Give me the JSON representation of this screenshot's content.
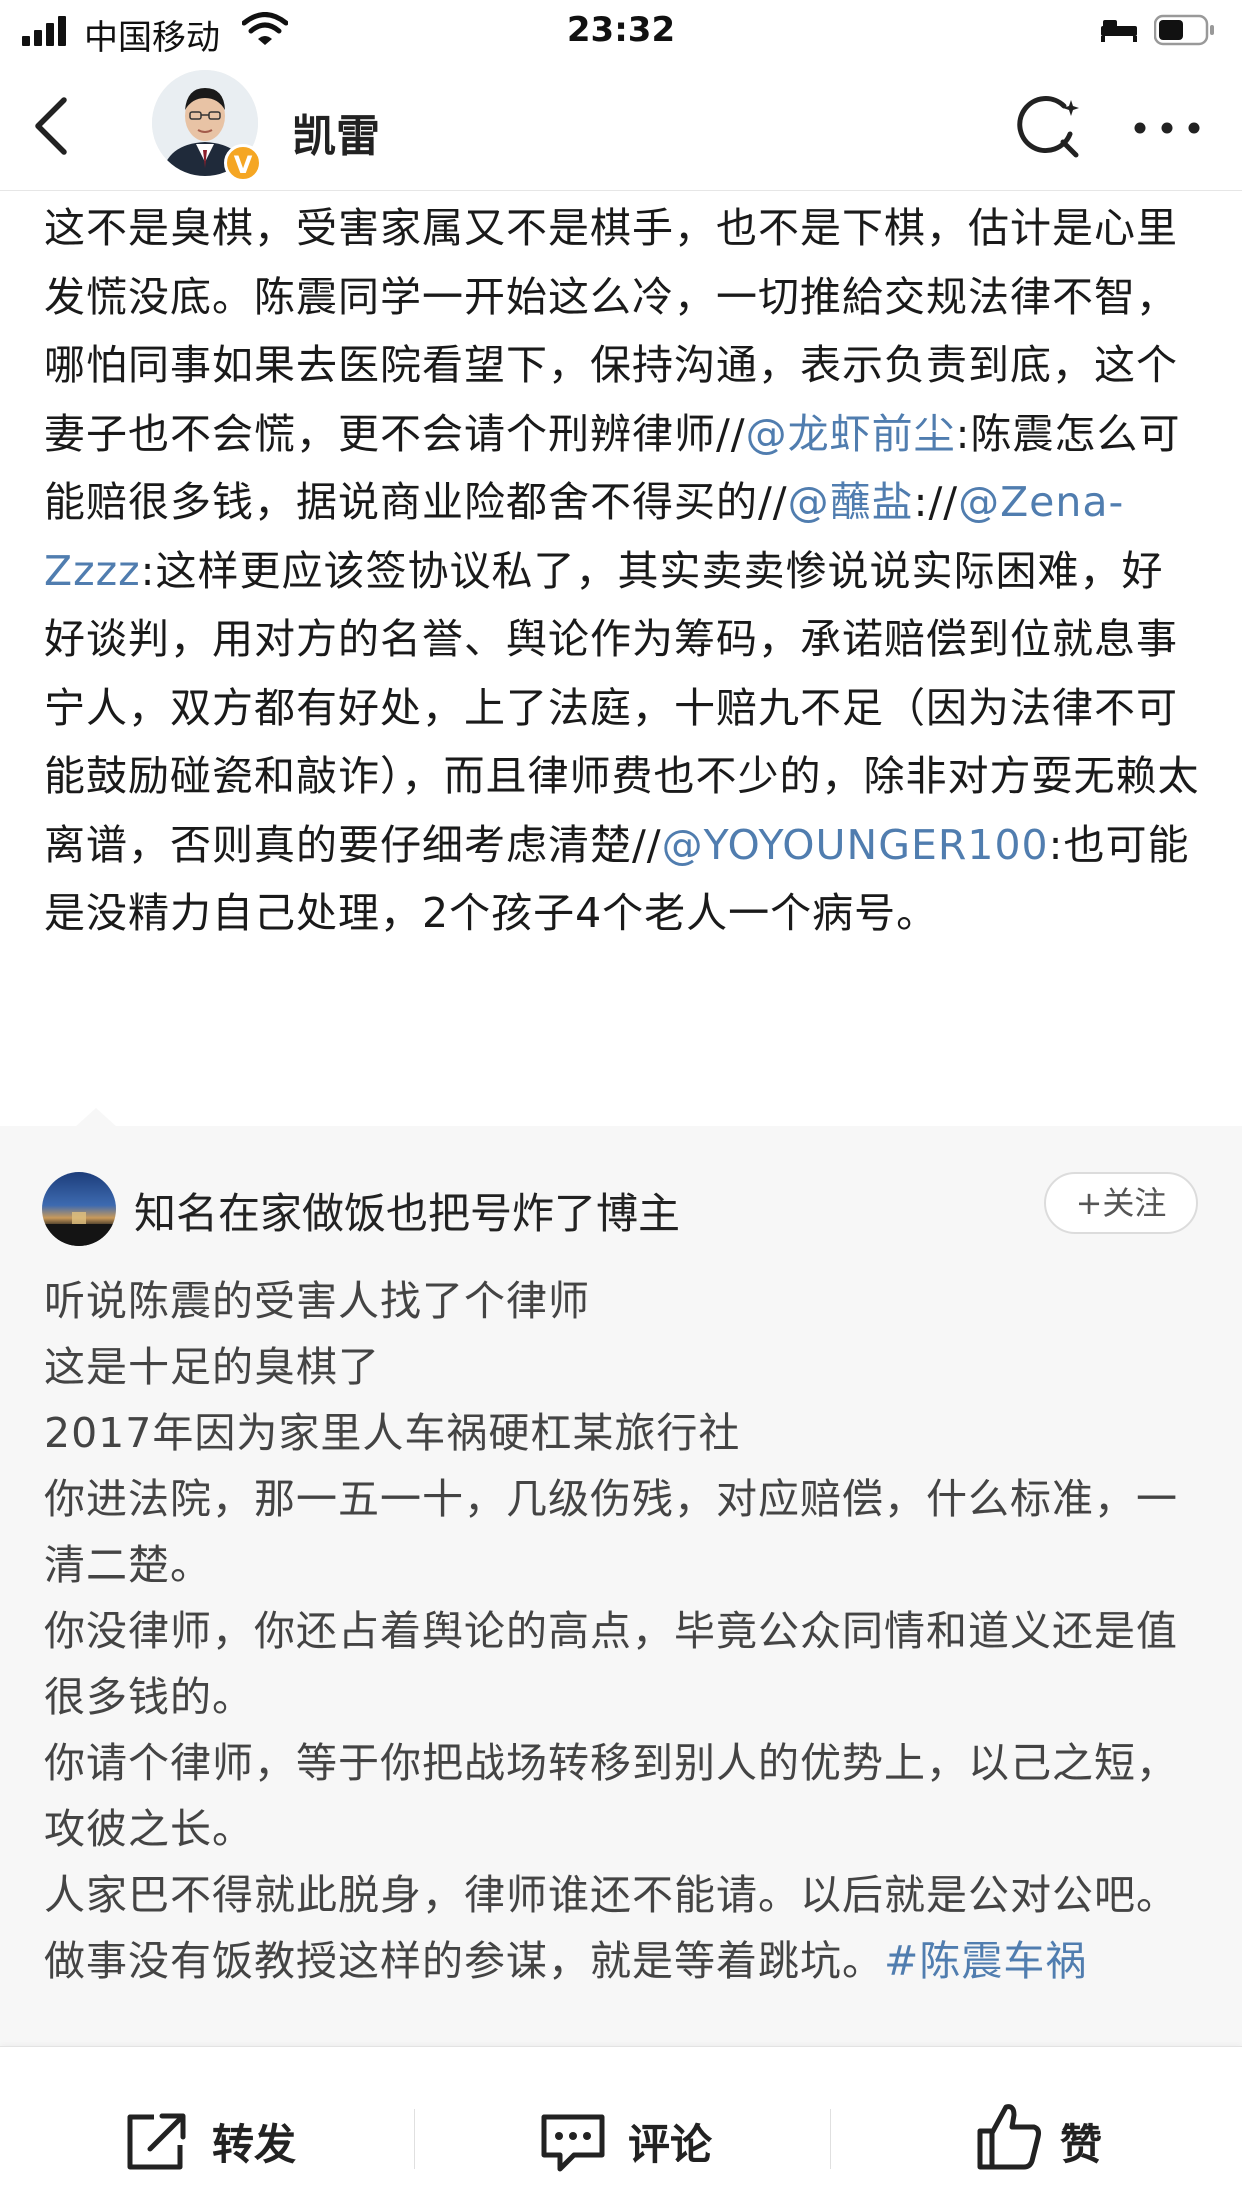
{
  "status_bar": {
    "carrier": "中国移动",
    "time": "23:32"
  },
  "header": {
    "username": "凯雷",
    "verified_badge": "V"
  },
  "post": {
    "segments": [
      {
        "type": "text",
        "text": "这不是臭棋，受害家属又不是棋手，也不是下棋，估计是心里发慌没底。陈震同学一开始这么冷，一切推給交规法律不智，哪怕同事如果去医院看望下，保持沟通，表示负责到底，这个妻子也不会慌，更不会请个刑辨律师//"
      },
      {
        "type": "mention",
        "text": "@龙虾前尘"
      },
      {
        "type": "text",
        "text": ":陈震怎么可能赔很多钱，据说商业险都舍不得买的//"
      },
      {
        "type": "mention",
        "text": "@蘸盐"
      },
      {
        "type": "text",
        "text": "://"
      },
      {
        "type": "mention",
        "text": "@Zena-Zzzz"
      },
      {
        "type": "text",
        "text": ":这样更应该签协议私了，其实卖卖惨说说实际困难，好好谈判，用对方的名誉、舆论作为筹码，承诺赔偿到位就息事宁人，双方都有好处，上了法庭，十赔九不足（因为法律不可能鼓励碰瓷和敲诈），而且律师费也不少的，除非对方耍无赖太离谱，否则真的要仔细考虑清楚//"
      },
      {
        "type": "mention",
        "text": "@YOYOUNGER100"
      },
      {
        "type": "text",
        "text": ":也可能是没精力自己处理，2个孩子4个老人一个病号。"
      }
    ]
  },
  "repost": {
    "author": "知名在家做饭也把号炸了博主",
    "follow_label": "+关注",
    "lines": [
      "听说陈震的受害人找了个律师",
      "这是十足的臭棋了",
      "2017年因为家里人车祸硬杠某旅行社",
      "你进法院，那一五一十，几级伤残，对应赔偿，什么标准，一清二楚。",
      "你没律师，你还占着舆论的高点，毕竟公众同情和道义还是值很多钱的。",
      "你请个律师，等于你把战场转移到别人的优势上，以己之短，攻彼之长。",
      "人家巴不得就此脱身，律师谁还不能请。以后就是公对公吧。"
    ],
    "last_line_text": "做事没有饭教授这样的参谋，就是等着跳坑。",
    "last_line_hashtag": "#陈震车祸"
  },
  "toolbar": {
    "repost_label": "转发",
    "comment_label": "评论",
    "like_label": "赞"
  },
  "colors": {
    "link": "#507daf",
    "verified_badge": "#f5a623",
    "repost_bg": "#f7f7f7"
  }
}
